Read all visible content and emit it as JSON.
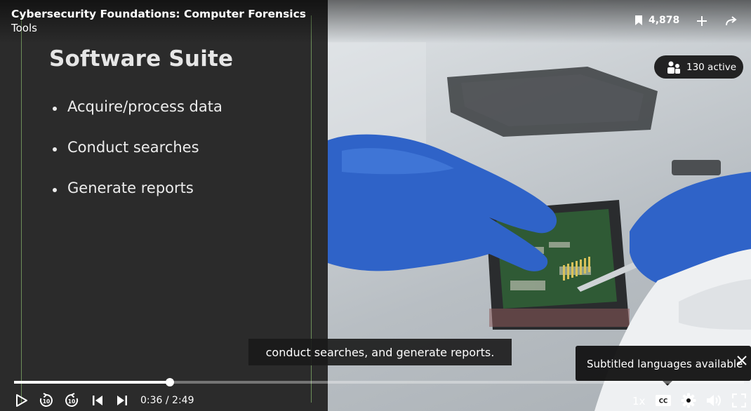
{
  "header": {
    "course_title": "Cybersecurity Foundations: Computer Forensics",
    "chapter_title": "Tools",
    "bookmark_count": "4,878"
  },
  "slide": {
    "title": "Software Suite",
    "bullets": [
      "Acquire/process data",
      "Conduct searches",
      "Generate reports"
    ]
  },
  "viewers": {
    "label": "130 active"
  },
  "caption": {
    "text": "conduct searches, and generate reports."
  },
  "tooltip": {
    "text": "Subtitled languages available"
  },
  "player": {
    "current_time": "0:36",
    "separator": "/",
    "duration": "2:49",
    "time_display": "0:36 / 2:49",
    "progress_fraction": 0.213,
    "speed": "1x",
    "rewind_seconds": "10",
    "forward_seconds": "10"
  },
  "icons": {
    "bookmark": "bookmark-icon",
    "add": "plus-icon",
    "share": "share-icon",
    "people": "people-icon",
    "play": "play-icon",
    "rewind": "rewind-10-icon",
    "forward": "forward-10-icon",
    "previous": "skip-previous-icon",
    "next": "skip-next-icon",
    "captions": "cc-icon",
    "settings": "gear-icon",
    "volume": "volume-icon",
    "fullscreen": "fullscreen-icon",
    "close": "close-icon"
  },
  "colors": {
    "slide_bg": "#2b2b2b",
    "slide_frame": "#6d8f5a",
    "glove_blue": "#2f63c8",
    "pcb_green": "#2f5a35"
  }
}
